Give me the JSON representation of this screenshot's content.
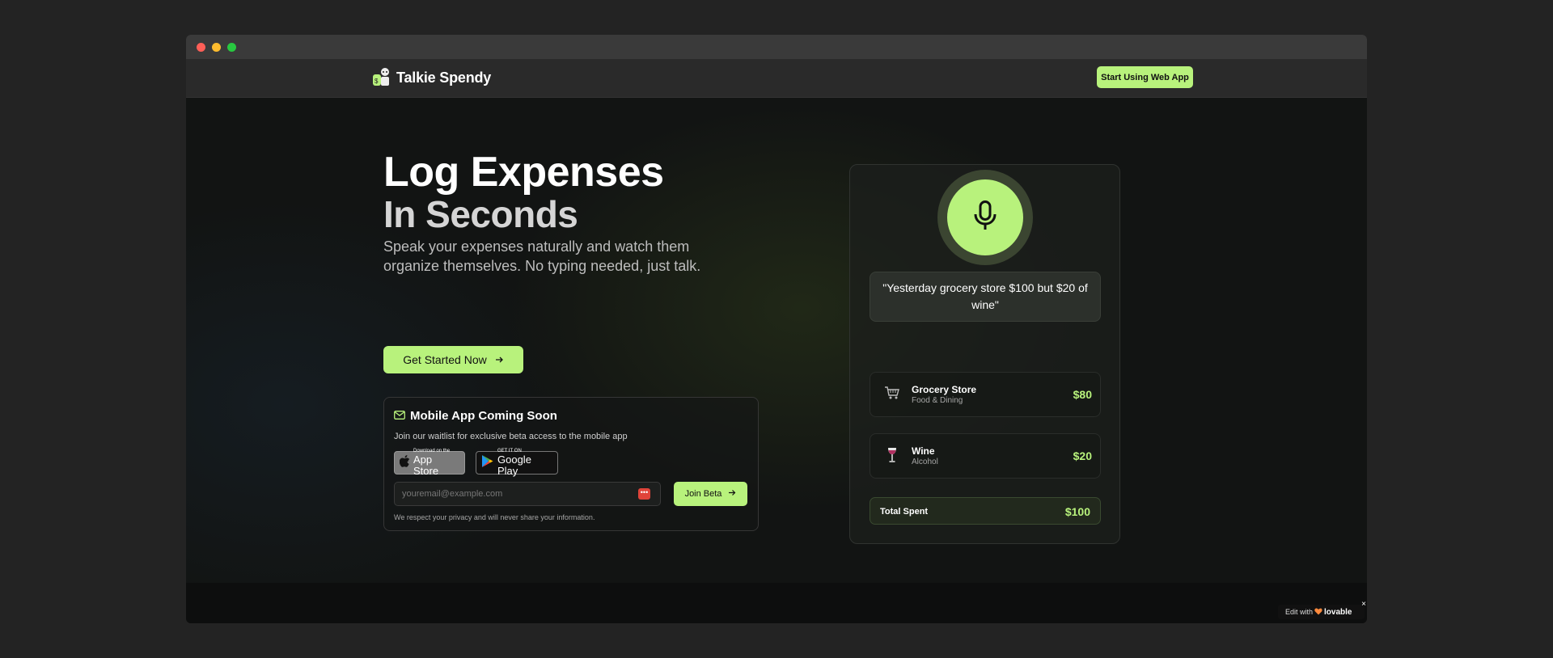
{
  "navbar": {
    "app_name": "Talkie Spendy",
    "cta_label": "Start Using Web App"
  },
  "hero": {
    "title_line1": "Log Expenses",
    "title_line2": "In Seconds",
    "subtitle": "Speak your expenses naturally and watch them organize themselves. No typing needed, just talk.",
    "cta_label": "Get Started Now"
  },
  "beta": {
    "title": "Mobile App Coming Soon",
    "description": "Join our waitlist for exclusive beta access to the mobile app",
    "app_store_small": "Download on the",
    "app_store_big": "App Store",
    "google_small": "GET IT ON",
    "google_big": "Google Play",
    "email_placeholder": "youremail@example.com",
    "join_label": "Join Beta",
    "privacy": "We respect your privacy and will never share your information."
  },
  "demo": {
    "quote": "\"Yesterday grocery store $100 but $20 of wine\"",
    "items": [
      {
        "name": "Grocery Store",
        "category": "Food & Dining",
        "amount": "$80",
        "icon": "shopping-cart-icon"
      },
      {
        "name": "Wine",
        "category": "Alcohol",
        "amount": "$20",
        "icon": "wine-glass-icon"
      }
    ],
    "total_label": "Total Spent",
    "total_amount": "$100"
  },
  "badge": {
    "prefix": "Edit with",
    "brand": "lovable",
    "close": "×"
  },
  "colors": {
    "accent": "#b8f27c",
    "background": "#121413"
  }
}
